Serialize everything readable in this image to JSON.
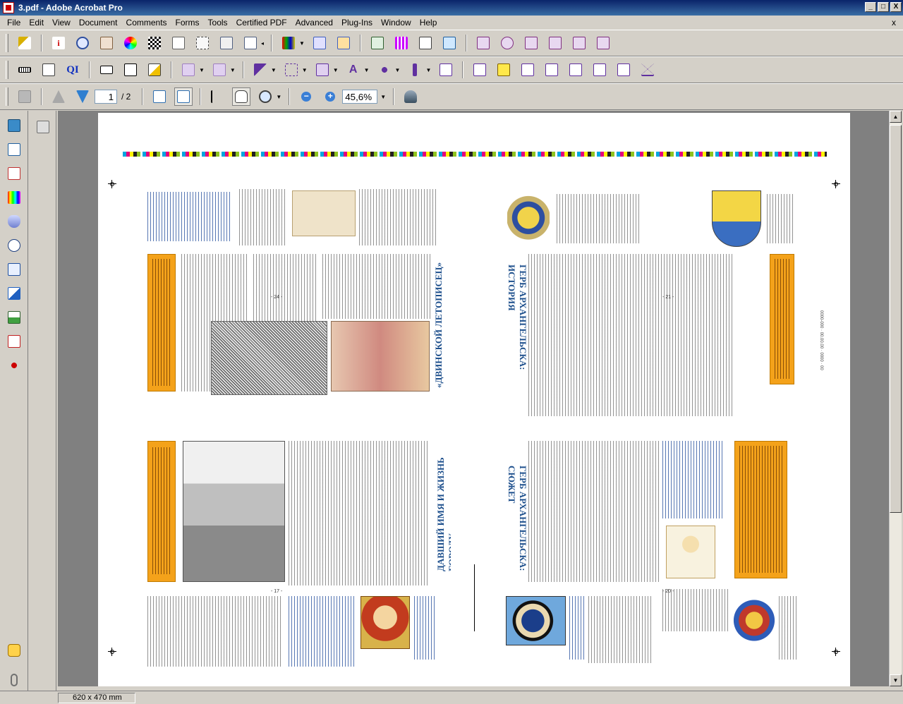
{
  "window": {
    "title": "3.pdf - Adobe Acrobat Pro",
    "controls": {
      "minimize": "_",
      "maximize": "□",
      "close": "X"
    }
  },
  "menu": {
    "items": [
      "File",
      "Edit",
      "View",
      "Document",
      "Comments",
      "Forms",
      "Tools",
      "Certified PDF",
      "Advanced",
      "Plug-Ins",
      "Window",
      "Help"
    ],
    "document_close": "x"
  },
  "navigation": {
    "current_page": "1",
    "page_total": "/ 2",
    "zoom": "45,6%"
  },
  "status": {
    "page_size": "620 x 470 mm"
  },
  "document": {
    "page_numbers": {
      "p24": "- 24 -",
      "p21": "- 21 -",
      "p17": "- 17 -",
      "p20": "- 20 -"
    }
  },
  "colors": {
    "titlebar": "#0a246a",
    "heading_blue": "#1d4f8c",
    "box_orange": "#f4a21a"
  }
}
